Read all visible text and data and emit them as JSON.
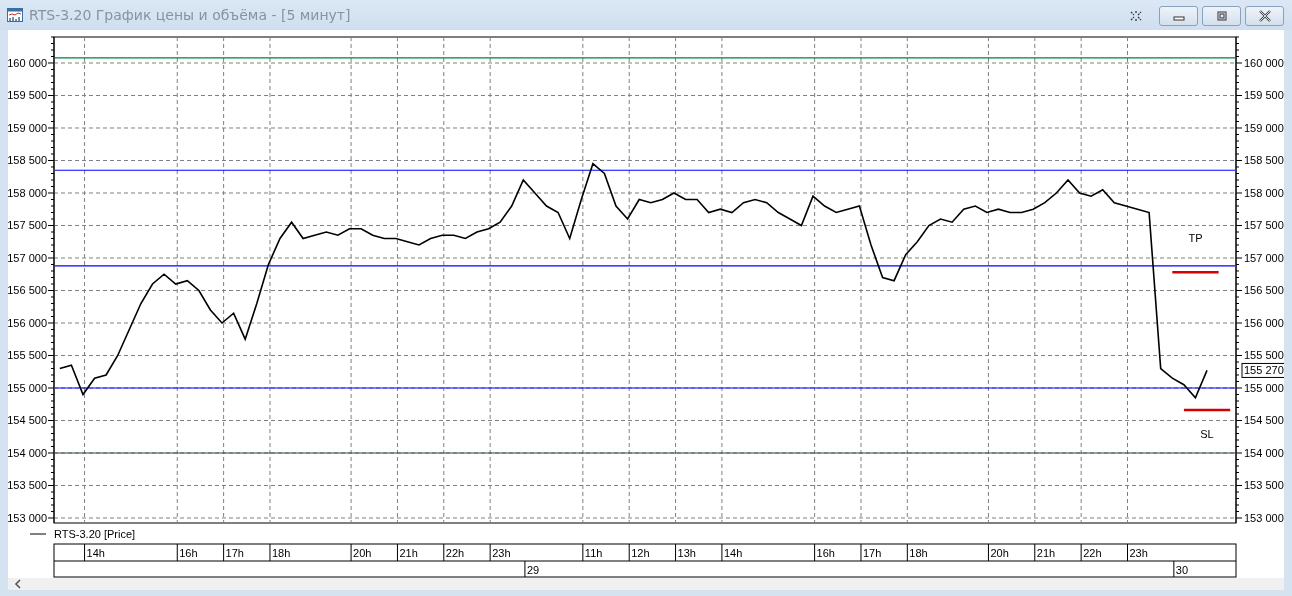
{
  "window": {
    "title": "RTS-3.20 График цены и объёма - [5 минут]"
  },
  "chart": {
    "chart_data": {
      "type": "line",
      "grid": true,
      "ylim": [
        152923,
        160400
      ],
      "categories": [
        null,
        null,
        null,
        "14h",
        null,
        null,
        null,
        null,
        null,
        null,
        null,
        "16h",
        null,
        null,
        null,
        "17h",
        null,
        null,
        null,
        "18h",
        null,
        null,
        null,
        null,
        null,
        null,
        "20h",
        null,
        null,
        null,
        "21h",
        null,
        null,
        null,
        "22h",
        null,
        null,
        null,
        "23h",
        null,
        null,
        null,
        null,
        null,
        null,
        null,
        "11h",
        null,
        null,
        null,
        "12h",
        null,
        null,
        null,
        "13h",
        null,
        null,
        null,
        "14h",
        null,
        null,
        null,
        null,
        null,
        null,
        null,
        "16h",
        null,
        null,
        null,
        "17h",
        null,
        null,
        null,
        "18h",
        null,
        null,
        null,
        null,
        null,
        null,
        "20h",
        null,
        null,
        null,
        "21h",
        null,
        null,
        null,
        "22h",
        null,
        null,
        null,
        "23h",
        null,
        null,
        null,
        null,
        null,
        null,
        null,
        null
      ],
      "series": [
        {
          "name": "RTS-3.20 [Price]",
          "color": "#000000",
          "values": [
            155300,
            155350,
            154900,
            155150,
            155200,
            155500,
            155900,
            156300,
            156600,
            156750,
            156600,
            156650,
            156500,
            156200,
            156000,
            156150,
            155750,
            156300,
            156900,
            157300,
            157550,
            157300,
            157350,
            157400,
            157350,
            157450,
            157450,
            157350,
            157300,
            157300,
            157250,
            157200,
            157300,
            157350,
            157350,
            157300,
            157400,
            157450,
            157550,
            157800,
            158200,
            158000,
            157800,
            157700,
            157300,
            157900,
            158450,
            158300,
            157800,
            157600,
            157900,
            157850,
            157900,
            158000,
            157900,
            157900,
            157700,
            157750,
            157700,
            157850,
            157900,
            157850,
            157700,
            157600,
            157500,
            157950,
            157800,
            157700,
            157750,
            157800,
            157200,
            156700,
            156650,
            157050,
            157250,
            157500,
            157600,
            157550,
            157750,
            157800,
            157700,
            157750,
            157700,
            157700,
            157750,
            157850,
            158000,
            158200,
            158000,
            157950,
            158050,
            157850,
            157800,
            157750,
            157700,
            155300,
            155150,
            155050,
            154850,
            155270,
            null,
            null
          ]
        },
        {
          "name": "TP",
          "color": "#d40000",
          "values": [
            null,
            null,
            null,
            null,
            null,
            null,
            null,
            null,
            null,
            null,
            null,
            null,
            null,
            null,
            null,
            null,
            null,
            null,
            null,
            null,
            null,
            null,
            null,
            null,
            null,
            null,
            null,
            null,
            null,
            null,
            null,
            null,
            null,
            null,
            null,
            null,
            null,
            null,
            null,
            null,
            null,
            null,
            null,
            null,
            null,
            null,
            null,
            null,
            null,
            null,
            null,
            null,
            null,
            null,
            null,
            null,
            null,
            null,
            null,
            null,
            null,
            null,
            null,
            null,
            null,
            null,
            null,
            null,
            null,
            null,
            null,
            null,
            null,
            null,
            null,
            null,
            null,
            null,
            null,
            null,
            null,
            null,
            null,
            null,
            null,
            null,
            null,
            null,
            null,
            null,
            null,
            null,
            null,
            null,
            null,
            null,
            156780,
            156780,
            156780,
            156780,
            156780,
            null
          ]
        },
        {
          "name": "SL",
          "color": "#d40000",
          "values": [
            null,
            null,
            null,
            null,
            null,
            null,
            null,
            null,
            null,
            null,
            null,
            null,
            null,
            null,
            null,
            null,
            null,
            null,
            null,
            null,
            null,
            null,
            null,
            null,
            null,
            null,
            null,
            null,
            null,
            null,
            null,
            null,
            null,
            null,
            null,
            null,
            null,
            null,
            null,
            null,
            null,
            null,
            null,
            null,
            null,
            null,
            null,
            null,
            null,
            null,
            null,
            null,
            null,
            null,
            null,
            null,
            null,
            null,
            null,
            null,
            null,
            null,
            null,
            null,
            null,
            null,
            null,
            null,
            null,
            null,
            null,
            null,
            null,
            null,
            null,
            null,
            null,
            null,
            null,
            null,
            null,
            null,
            null,
            null,
            null,
            null,
            null,
            null,
            null,
            null,
            null,
            null,
            null,
            null,
            null,
            null,
            null,
            154660,
            154660,
            154660,
            154660,
            154660
          ]
        }
      ],
      "ref_lines": [
        {
          "axis": "y",
          "value": 160080,
          "color": "#00803c"
        },
        {
          "axis": "y",
          "value": 158350,
          "color": "#0000ff"
        },
        {
          "axis": "y",
          "value": 156880,
          "color": "#0000ff"
        },
        {
          "axis": "y",
          "value": 155000,
          "color": "#0000ff"
        },
        {
          "axis": "y",
          "value": 154000,
          "color": "#2e4f3a"
        }
      ],
      "yticks": [
        {
          "value": 160000,
          "label": "160 000"
        },
        {
          "value": 159500,
          "label": "159 500"
        },
        {
          "value": 159000,
          "label": "159 000"
        },
        {
          "value": 158500,
          "label": "158 500"
        },
        {
          "value": 158000,
          "label": "158 000"
        },
        {
          "value": 157500,
          "label": "157 500"
        },
        {
          "value": 157000,
          "label": "157 000"
        },
        {
          "value": 156500,
          "label": "156 500"
        },
        {
          "value": 156000,
          "label": "156 000"
        },
        {
          "value": 155500,
          "label": "155 500"
        },
        {
          "value": 155000,
          "label": "155 000"
        },
        {
          "value": 154500,
          "label": "154 500"
        },
        {
          "value": 154000,
          "label": "154 000"
        },
        {
          "value": 153500,
          "label": "153 500"
        },
        {
          "value": 153000,
          "label": "153 000"
        }
      ],
      "annotations": [
        "155 270"
      ]
    },
    "date_row": [
      "29",
      "30"
    ]
  }
}
